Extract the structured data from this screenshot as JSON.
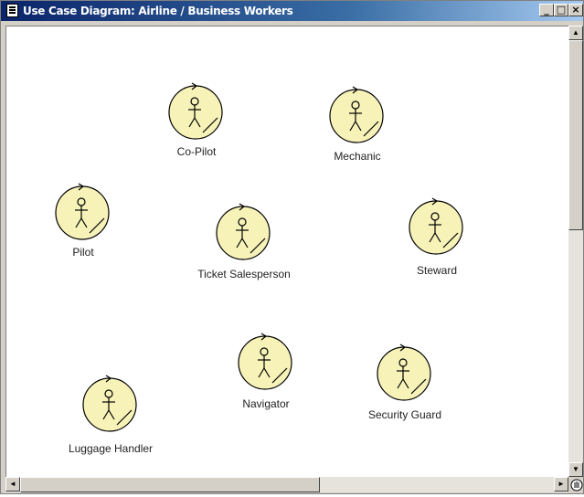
{
  "window": {
    "title": "Use Case Diagram: Airline / Business Workers",
    "buttons": {
      "minimize": "_",
      "maximize": "□",
      "close": "×"
    }
  },
  "diagram": {
    "actor_icon": "business-worker-icon",
    "actor_fill": "#f7f3b8",
    "actors": [
      {
        "label": "Co-Pilot"
      },
      {
        "label": "Mechanic"
      },
      {
        "label": "Pilot"
      },
      {
        "label": "Ticket Salesperson"
      },
      {
        "label": "Steward"
      },
      {
        "label": "Navigator"
      },
      {
        "label": "Security Guard"
      },
      {
        "label": "Luggage Handler"
      }
    ]
  },
  "scrollbars": {
    "up_arrow": "▲",
    "down_arrow": "▼",
    "left_arrow": "◄",
    "right_arrow": "►"
  }
}
